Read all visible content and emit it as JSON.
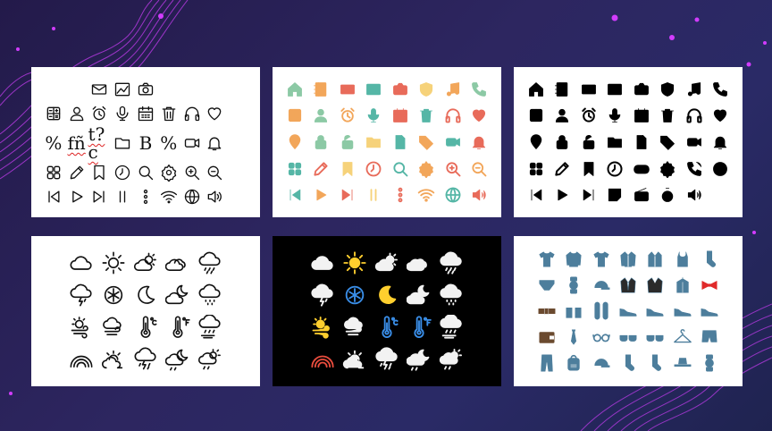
{
  "panels": [
    {
      "id": "outline-icon-panel",
      "theme": "light",
      "rows": [
        [
          null,
          null,
          "mail",
          "chart-image",
          "camera",
          null,
          null,
          null,
          null
        ],
        [
          "calculator",
          "user",
          "alarm",
          "mic",
          "calendar",
          "trash",
          "headphones",
          "heart",
          null
        ],
        [
          {
            "text": "%"
          },
          {
            "text": "fñ",
            "squiggle": true
          },
          {
            "text": "t?c",
            "squiggle": true
          },
          "folder",
          {
            "text": "B"
          },
          {
            "text": "%"
          },
          "video",
          "bell",
          null
        ],
        [
          "grid",
          "pencil",
          "bookmark",
          "clock",
          "search",
          "gear",
          "zoom-in",
          "zoom-out",
          null
        ],
        [
          "skip-back",
          "play",
          "skip-forward",
          "pause",
          "dots-vertical",
          "wifi",
          "globe",
          "volume",
          null
        ]
      ]
    },
    {
      "id": "flat-color-icon-panel",
      "theme": "light",
      "rows": [
        [
          "home",
          "notebook",
          "mail",
          "picture",
          "camera",
          "shield",
          "music",
          "phone"
        ],
        [
          "calculator",
          "user",
          "alarm",
          "mic",
          "calendar",
          "trash",
          "headphones",
          "heart"
        ],
        [
          "location",
          "lock",
          "unlock",
          "folder",
          "file",
          "tag",
          "video",
          "bell"
        ],
        [
          "grid",
          "pencil",
          "bookmark",
          "clock",
          "search",
          "gear",
          "zoom-in",
          "zoom-out"
        ],
        [
          "skip-back",
          "play",
          "skip-forward",
          "pause",
          "dots-vertical",
          "wifi",
          "globe",
          "volume"
        ]
      ]
    },
    {
      "id": "solid-black-icon-panel",
      "theme": "light",
      "rows": [
        [
          "home",
          "notebook",
          "mail",
          "picture",
          "camera",
          "shield",
          "music",
          "phone"
        ],
        [
          "calculator",
          "user",
          "alarm",
          "mic",
          "calendar",
          "trash",
          "headphones",
          "heart"
        ],
        [
          "location",
          "lock",
          "unlock",
          "folder",
          "file",
          "tag",
          "video",
          "bell"
        ],
        [
          "grid",
          "pencil",
          "bookmark",
          "clock",
          "gamepad",
          "gear",
          "phone-call",
          "help"
        ],
        [
          "skip-back",
          "play",
          "skip-forward",
          "note",
          "radio",
          "timer",
          "volume",
          null
        ]
      ]
    },
    {
      "id": "weather-outline-icon-panel",
      "theme": "light",
      "rows": [
        [
          "cloud",
          "sun",
          "partly-cloudy",
          "cloudy",
          "rain-cloud"
        ],
        [
          "thunder-cloud",
          "snowflake",
          "moon",
          "moon-cloud",
          "sleet-cloud"
        ],
        [
          "sun-wind",
          "cloud-wind",
          "thermometer-c",
          "thermometer-f",
          "rain-wind"
        ],
        [
          "rainbow",
          "sunset-cloud",
          "storm-rain",
          "moon-rain",
          "sun-cloud-rain"
        ]
      ]
    },
    {
      "id": "weather-color-icon-panel",
      "theme": "dark",
      "rows": [
        [
          "cloud",
          "sun",
          "partly-cloudy",
          "cloudy",
          "rain-cloud"
        ],
        [
          "thunder-cloud",
          "snowflake",
          "moon",
          "moon-cloud",
          "sleet-cloud"
        ],
        [
          "sun-wind",
          "cloud-wind",
          "thermometer-c",
          "thermometer-f",
          "rain-wind"
        ],
        [
          "rainbow",
          "sunset-cloud",
          "storm-rain",
          "moon-rain",
          "sun-cloud-rain"
        ]
      ]
    },
    {
      "id": "clothing-icon-panel",
      "theme": "light",
      "rows": [
        [
          "tshirt",
          "sweater",
          "tshirt",
          "jacket",
          "coat",
          "tank-top",
          "sock"
        ],
        [
          "underwear",
          "watch",
          "cap",
          "suit",
          "blazer",
          "hanger-coat",
          "bow-tie"
        ],
        [
          "belt",
          "sandals",
          "flip-flops",
          "sneaker",
          "sneaker",
          "sneaker",
          "sneaker"
        ],
        [
          "wallet",
          "tie",
          "glasses",
          "sunglasses",
          "sunglasses",
          "hanger",
          "shorts"
        ],
        [
          "pants",
          "backpack",
          "cap",
          "sock",
          "sock",
          "bucket-hat",
          "watch"
        ]
      ]
    }
  ],
  "colors": {
    "background": "#2a2660",
    "accent_magenta": "#d23cff",
    "ink": "#111111",
    "flat_green": "#8cc9a5",
    "flat_orange": "#f2a65a",
    "flat_red": "#e86b5a",
    "flat_yellow": "#f6d27a",
    "flat_teal": "#55b6a6",
    "weather_cloud": "#f2f2f2",
    "weather_sun": "#ffcf2e",
    "weather_blue": "#3a8ee8",
    "clothing_blue": "#4d7e9c",
    "clothing_red": "#e02a2a",
    "clothing_dark": "#2b2b2b"
  }
}
